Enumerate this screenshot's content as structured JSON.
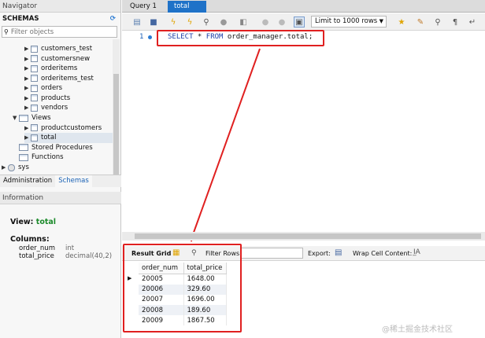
{
  "navigator": {
    "title": "Navigator",
    "schemas_label": "SCHEMAS",
    "filter_placeholder": "Filter objects",
    "tree": [
      {
        "label": "customers_test",
        "kind": "table"
      },
      {
        "label": "customersnew",
        "kind": "table"
      },
      {
        "label": "orderitems",
        "kind": "table"
      },
      {
        "label": "orderitems_test",
        "kind": "table"
      },
      {
        "label": "orders",
        "kind": "table"
      },
      {
        "label": "products",
        "kind": "table"
      },
      {
        "label": "vendors",
        "kind": "table"
      },
      {
        "label": "Views",
        "kind": "folder"
      },
      {
        "label": "productcustomers",
        "kind": "view"
      },
      {
        "label": "total",
        "kind": "view"
      },
      {
        "label": "Stored Procedures",
        "kind": "folder"
      },
      {
        "label": "Functions",
        "kind": "folder"
      },
      {
        "label": "sys",
        "kind": "schema"
      }
    ],
    "tabs": [
      "Administration",
      "Schemas"
    ],
    "info_title": "Information",
    "info": {
      "view_label": "View:",
      "view_name": "total",
      "columns_label": "Columns:",
      "columns": [
        {
          "name": "order_num",
          "type": "int"
        },
        {
          "name": "total_price",
          "type": "decimal(40,2)"
        }
      ]
    }
  },
  "tabs": [
    "Query 1",
    "total"
  ],
  "toolbar": {
    "limit": "Limit to 1000 rows"
  },
  "editor": {
    "line_number": "1",
    "sql_kw1": "SELECT",
    "sql_rest1": " * ",
    "sql_kw2": "FROM",
    "sql_rest2": " order_manager.total;"
  },
  "results": {
    "result_grid": "Result Grid",
    "filter_rows": "Filter Rows:",
    "export": "Export:",
    "wrap": "Wrap Cell Content:",
    "columns": [
      "order_num",
      "total_price"
    ],
    "rows": [
      [
        "20005",
        "1648.00"
      ],
      [
        "20006",
        "329.60"
      ],
      [
        "20007",
        "1696.00"
      ],
      [
        "20008",
        "189.60"
      ],
      [
        "20009",
        "1867.50"
      ]
    ]
  },
  "watermark": "@稀土掘金技术社区",
  "colors": {
    "highlight": "#e02020",
    "accent": "#1a62b5",
    "view_name": "#1b8a2a"
  }
}
